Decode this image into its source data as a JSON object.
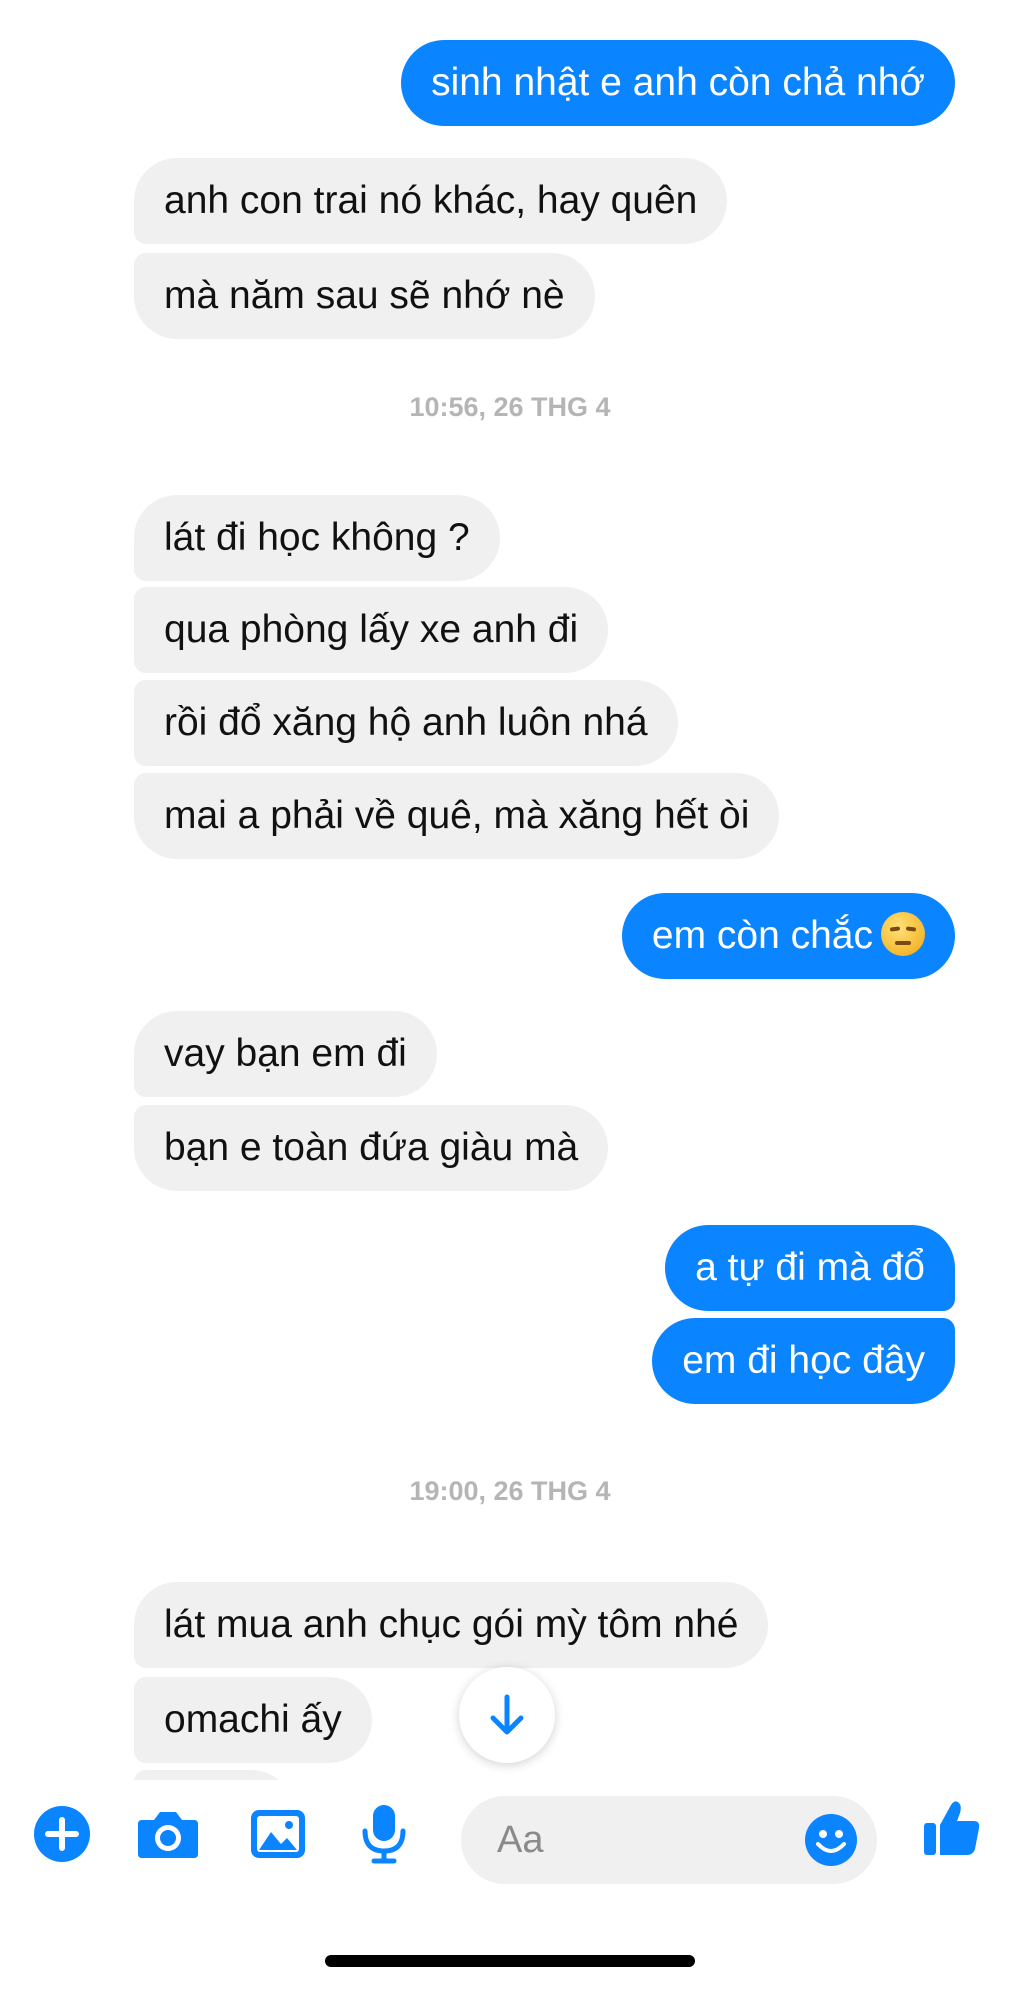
{
  "app": {
    "accent_color": "#0a84ff",
    "incoming_bubble_color": "#f0f0f0"
  },
  "messages": [
    {
      "from": "me",
      "text": "sinh nhật e anh còn chả nhớ"
    },
    {
      "from": "other",
      "text": "anh con trai nó khác, hay quên"
    },
    {
      "from": "other",
      "text": "mà năm sau sẽ nhớ nè"
    },
    {
      "from": "other",
      "text": "lát đi học không ?"
    },
    {
      "from": "other",
      "text": "qua phòng lấy xe anh đi"
    },
    {
      "from": "other",
      "text": "rồi đổ xăng hộ anh luôn nhá"
    },
    {
      "from": "other",
      "text": "mai a phải về quê, mà xăng hết òi"
    },
    {
      "from": "me",
      "text": "em còn chắc",
      "emoji": "unamused-face-emoji"
    },
    {
      "from": "other",
      "text": "vay bạn em đi"
    },
    {
      "from": "other",
      "text": "bạn e toàn đứa giàu mà"
    },
    {
      "from": "me",
      "text": "a tự đi mà đổ"
    },
    {
      "from": "me",
      "text": "em đi học đây"
    },
    {
      "from": "other",
      "text": "lát mua anh chục gói mỳ tôm nhé"
    },
    {
      "from": "other",
      "text": "omachi ấy"
    }
  ],
  "timestamps": [
    "10:56, 26 THG 4",
    "19:00, 26 THG 4"
  ],
  "composer": {
    "placeholder": "Aa",
    "icons": [
      "plus-icon",
      "camera-icon",
      "gallery-icon",
      "microphone-icon",
      "emoji-icon",
      "thumbs-up-icon"
    ]
  },
  "scroll_button": {
    "icon": "arrow-down-icon"
  }
}
